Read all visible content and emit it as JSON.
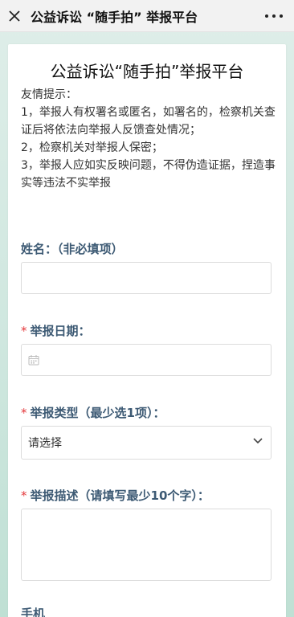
{
  "topbar": {
    "title": "公益诉讼 “随手拍” 举报平台",
    "close_icon": "close-icon",
    "more_icon": "more-dots-icon"
  },
  "form": {
    "title": "公益诉讼“随手拍”举报平台",
    "tips": [
      "友情提示：",
      "1，举报人有权署名或匿名，如署名的，检察机关查证后将依法向举报人反馈查处情况；",
      "2，检察机关对举报人保密；",
      "3，举报人应如实反映问题，不得伪造证据，捏造事实等违法不实举报"
    ],
    "name_label": "姓名：（非必填项）",
    "required_mark": "*",
    "date_label": "举报日期：",
    "type_label": "举报类型（最少选1项）：",
    "type_value": "请选择",
    "desc_label": "举报描述（请填写最少10个字）：",
    "phone_label": "手机"
  },
  "colors": {
    "label": "#3d5a74",
    "required": "#e4393c",
    "background": "#cfe7df"
  }
}
